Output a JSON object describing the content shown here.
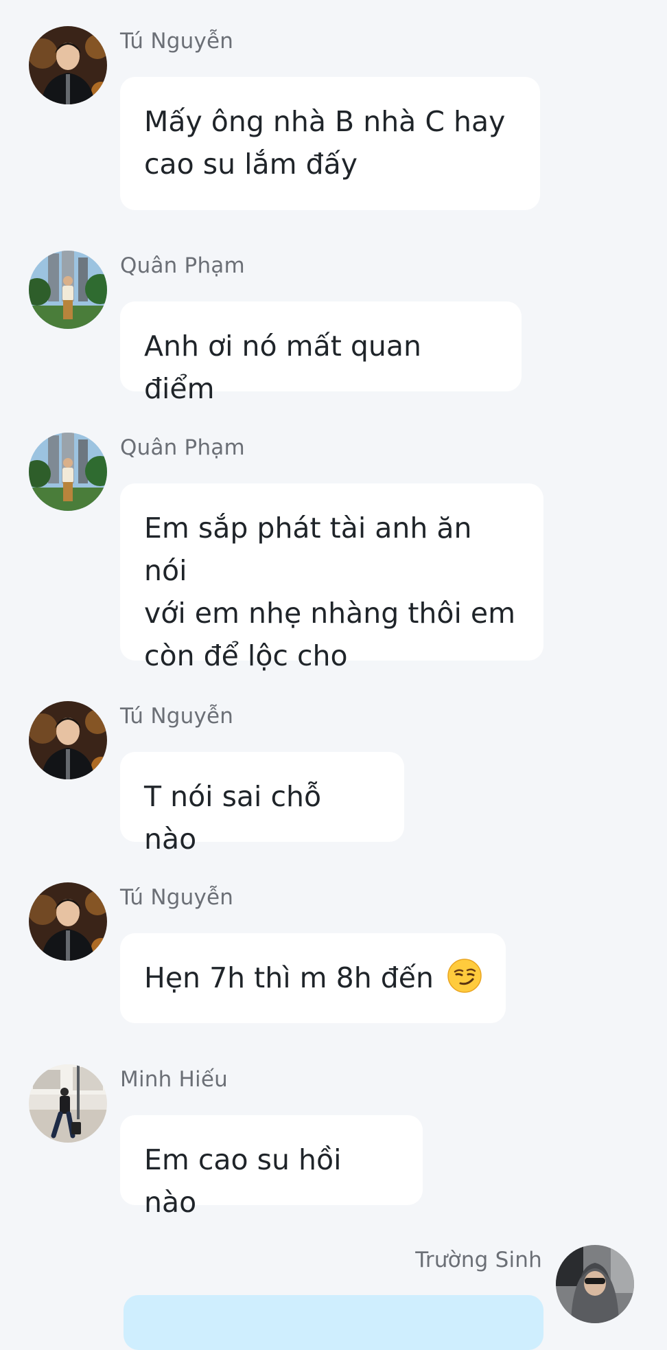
{
  "messages": [
    {
      "sender": "Tú Nguyễn",
      "avatar": "tu-nguyen-avatar",
      "lines": [
        "Mấy ông nhà B nhà C hay",
        "cao su lắm đấy"
      ]
    },
    {
      "sender": "Quân Phạm",
      "avatar": "quan-pham-avatar",
      "lines": [
        "Anh ơi nó mất quan điểm"
      ]
    },
    {
      "sender": "Quân Phạm",
      "avatar": "quan-pham-avatar",
      "lines": [
        "Em sắp phát tài anh ăn nói",
        "với em nhẹ nhàng thôi em",
        "còn để lộc cho"
      ]
    },
    {
      "sender": "Tú Nguyễn",
      "avatar": "tu-nguyen-avatar",
      "lines": [
        "T nói sai chỗ nào"
      ]
    },
    {
      "sender": "Tú Nguyễn",
      "avatar": "tu-nguyen-avatar",
      "lines": [
        "Hẹn 7h thì m 8h đến"
      ],
      "emoji": "smirking-face-emoji"
    },
    {
      "sender": "Minh Hiếu",
      "avatar": "minh-hieu-avatar",
      "lines": [
        "Em cao su hồi nào"
      ]
    },
    {
      "sender": "Trường Sinh",
      "avatar": "truong-sinh-avatar",
      "own": true
    }
  ],
  "colors": {
    "background": "#f4f6f9",
    "bubble": "#ffffff",
    "own_bubble": "#cfeefe",
    "sender_text": "#6b6f76",
    "message_text": "#1f2429"
  }
}
